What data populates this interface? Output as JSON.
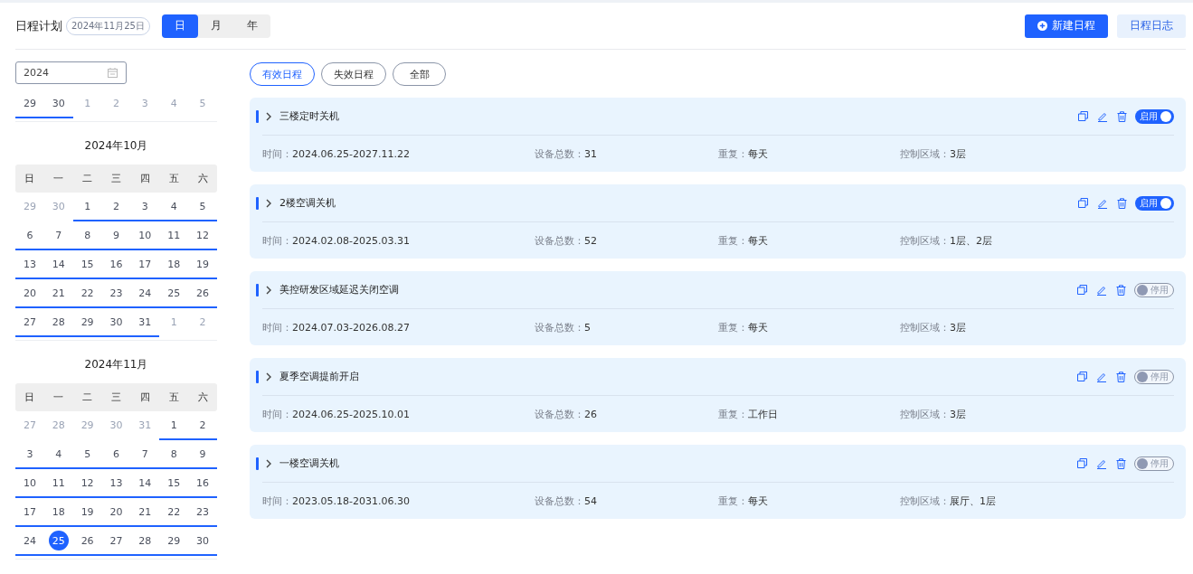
{
  "header": {
    "title": "日程计划",
    "date_badge": "2024年11月25日",
    "view_tabs": [
      {
        "label": "日",
        "selected": true
      },
      {
        "label": "月",
        "selected": false
      },
      {
        "label": "年",
        "selected": false
      }
    ],
    "buttons": [
      {
        "kind": "primary",
        "label": "新建日程"
      },
      {
        "kind": "secondary",
        "label": "日程日志"
      }
    ]
  },
  "calendar": {
    "year_field": {
      "value": "2024"
    },
    "partial_week": [
      {
        "label": "29",
        "muted": false,
        "selected": false
      },
      {
        "label": "30",
        "muted": false,
        "selected": false
      },
      {
        "label": "1",
        "muted": true,
        "selected": false
      },
      {
        "label": "2",
        "muted": true,
        "selected": false
      },
      {
        "label": "3",
        "muted": true,
        "selected": false
      },
      {
        "label": "4",
        "muted": true,
        "selected": false
      },
      {
        "label": "5",
        "muted": true,
        "selected": false
      }
    ],
    "months": [
      {
        "title": "2024年10月",
        "weekdays": [
          "日",
          "一",
          "二",
          "三",
          "四",
          "五",
          "六"
        ],
        "weeks": [
          [
            {
              "label": "29",
              "muted": true,
              "selected": false
            },
            {
              "label": "30",
              "muted": true,
              "selected": false
            },
            {
              "label": "1",
              "muted": false,
              "selected": false
            },
            {
              "label": "2",
              "muted": false,
              "selected": false
            },
            {
              "label": "3",
              "muted": false,
              "selected": false
            },
            {
              "label": "4",
              "muted": false,
              "selected": false
            },
            {
              "label": "5",
              "muted": false,
              "selected": false
            }
          ],
          [
            {
              "label": "6",
              "muted": false,
              "selected": false
            },
            {
              "label": "7",
              "muted": false,
              "selected": false
            },
            {
              "label": "8",
              "muted": false,
              "selected": false
            },
            {
              "label": "9",
              "muted": false,
              "selected": false
            },
            {
              "label": "10",
              "muted": false,
              "selected": false
            },
            {
              "label": "11",
              "muted": false,
              "selected": false
            },
            {
              "label": "12",
              "muted": false,
              "selected": false
            }
          ],
          [
            {
              "label": "13",
              "muted": false,
              "selected": false
            },
            {
              "label": "14",
              "muted": false,
              "selected": false
            },
            {
              "label": "15",
              "muted": false,
              "selected": false
            },
            {
              "label": "16",
              "muted": false,
              "selected": false
            },
            {
              "label": "17",
              "muted": false,
              "selected": false
            },
            {
              "label": "18",
              "muted": false,
              "selected": false
            },
            {
              "label": "19",
              "muted": false,
              "selected": false
            }
          ],
          [
            {
              "label": "20",
              "muted": false,
              "selected": false
            },
            {
              "label": "21",
              "muted": false,
              "selected": false
            },
            {
              "label": "22",
              "muted": false,
              "selected": false
            },
            {
              "label": "23",
              "muted": false,
              "selected": false
            },
            {
              "label": "24",
              "muted": false,
              "selected": false
            },
            {
              "label": "25",
              "muted": false,
              "selected": false
            },
            {
              "label": "26",
              "muted": false,
              "selected": false
            }
          ],
          [
            {
              "label": "27",
              "muted": false,
              "selected": false
            },
            {
              "label": "28",
              "muted": false,
              "selected": false
            },
            {
              "label": "29",
              "muted": false,
              "selected": false
            },
            {
              "label": "30",
              "muted": false,
              "selected": false
            },
            {
              "label": "31",
              "muted": false,
              "selected": false
            },
            {
              "label": "1",
              "muted": true,
              "selected": false
            },
            {
              "label": "2",
              "muted": true,
              "selected": false
            }
          ]
        ]
      },
      {
        "title": "2024年11月",
        "weekdays": [
          "日",
          "一",
          "二",
          "三",
          "四",
          "五",
          "六"
        ],
        "weeks": [
          [
            {
              "label": "27",
              "muted": true,
              "selected": false
            },
            {
              "label": "28",
              "muted": true,
              "selected": false
            },
            {
              "label": "29",
              "muted": true,
              "selected": false
            },
            {
              "label": "30",
              "muted": true,
              "selected": false
            },
            {
              "label": "31",
              "muted": true,
              "selected": false
            },
            {
              "label": "1",
              "muted": false,
              "selected": false
            },
            {
              "label": "2",
              "muted": false,
              "selected": false
            }
          ],
          [
            {
              "label": "3",
              "muted": false,
              "selected": false
            },
            {
              "label": "4",
              "muted": false,
              "selected": false
            },
            {
              "label": "5",
              "muted": false,
              "selected": false
            },
            {
              "label": "6",
              "muted": false,
              "selected": false
            },
            {
              "label": "7",
              "muted": false,
              "selected": false
            },
            {
              "label": "8",
              "muted": false,
              "selected": false
            },
            {
              "label": "9",
              "muted": false,
              "selected": false
            }
          ],
          [
            {
              "label": "10",
              "muted": false,
              "selected": false
            },
            {
              "label": "11",
              "muted": false,
              "selected": false
            },
            {
              "label": "12",
              "muted": false,
              "selected": false
            },
            {
              "label": "13",
              "muted": false,
              "selected": false
            },
            {
              "label": "14",
              "muted": false,
              "selected": false
            },
            {
              "label": "15",
              "muted": false,
              "selected": false
            },
            {
              "label": "16",
              "muted": false,
              "selected": false
            }
          ],
          [
            {
              "label": "17",
              "muted": false,
              "selected": false
            },
            {
              "label": "18",
              "muted": false,
              "selected": false
            },
            {
              "label": "19",
              "muted": false,
              "selected": false
            },
            {
              "label": "20",
              "muted": false,
              "selected": false
            },
            {
              "label": "21",
              "muted": false,
              "selected": false
            },
            {
              "label": "22",
              "muted": false,
              "selected": false
            },
            {
              "label": "23",
              "muted": false,
              "selected": false
            }
          ],
          [
            {
              "label": "24",
              "muted": false,
              "selected": false
            },
            {
              "label": "25",
              "muted": false,
              "selected": true
            },
            {
              "label": "26",
              "muted": false,
              "selected": false
            },
            {
              "label": "27",
              "muted": false,
              "selected": false
            },
            {
              "label": "28",
              "muted": false,
              "selected": false
            },
            {
              "label": "29",
              "muted": false,
              "selected": false
            },
            {
              "label": "30",
              "muted": false,
              "selected": false
            }
          ]
        ]
      }
    ]
  },
  "filters": [
    {
      "label": "有效日程",
      "selected": true
    },
    {
      "label": "失效日程",
      "selected": false
    },
    {
      "label": "全部",
      "selected": false
    }
  ],
  "schedules": [
    {
      "title": "三楼定时关机",
      "enabled": true,
      "toggle_label": "启用",
      "fields": [
        {
          "label": "时间：",
          "value": "2024.06.25-2027.11.22"
        },
        {
          "label": "设备总数：",
          "value": "31"
        },
        {
          "label": "重复：",
          "value": "每天"
        },
        {
          "label": "控制区域：",
          "value": "3层"
        }
      ]
    },
    {
      "title": "2楼空调关机",
      "enabled": true,
      "toggle_label": "启用",
      "fields": [
        {
          "label": "时间：",
          "value": "2024.02.08-2025.03.31"
        },
        {
          "label": "设备总数：",
          "value": "52"
        },
        {
          "label": "重复：",
          "value": "每天"
        },
        {
          "label": "控制区域：",
          "value": "1层、2层"
        }
      ]
    },
    {
      "title": "美控研发区域延迟关闭空调",
      "enabled": false,
      "toggle_label": "停用",
      "fields": [
        {
          "label": "时间：",
          "value": "2024.07.03-2026.08.27"
        },
        {
          "label": "设备总数：",
          "value": "5"
        },
        {
          "label": "重复：",
          "value": "每天"
        },
        {
          "label": "控制区域：",
          "value": "3层"
        }
      ]
    },
    {
      "title": "夏季空调提前开启",
      "enabled": false,
      "toggle_label": "停用",
      "fields": [
        {
          "label": "时间：",
          "value": "2024.06.25-2025.10.01"
        },
        {
          "label": "设备总数：",
          "value": "26"
        },
        {
          "label": "重复：",
          "value": "工作日"
        },
        {
          "label": "控制区域：",
          "value": "3层"
        }
      ]
    },
    {
      "title": "一楼空调关机",
      "enabled": false,
      "toggle_label": "停用",
      "fields": [
        {
          "label": "时间：",
          "value": "2023.05.18-2031.06.30"
        },
        {
          "label": "设备总数：",
          "value": "54"
        },
        {
          "label": "重复：",
          "value": "每天"
        },
        {
          "label": "控制区域：",
          "value": "展厅、1层"
        }
      ]
    }
  ]
}
